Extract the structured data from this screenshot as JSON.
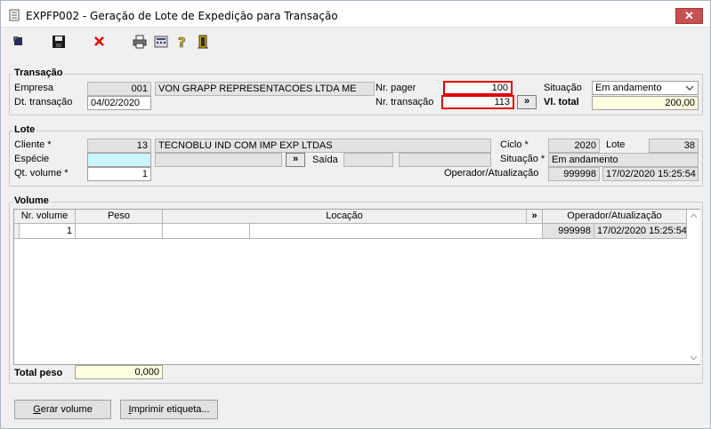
{
  "window": {
    "title": "EXPFP002 - Geração de Lote de Expedição para Transação",
    "close_label": "✕"
  },
  "toolbar": {
    "icons": [
      "exit-icon",
      "save-icon",
      "cancel-icon",
      "print-icon",
      "calculator-icon",
      "help-icon",
      "door-icon"
    ]
  },
  "transacao": {
    "title": "Transação",
    "empresa_label": "Empresa",
    "empresa_code": "001",
    "empresa_name": "VON GRAPP REPRESENTACOES LTDA ME",
    "dt_label": "Dt. transação",
    "dt_value": "04/02/2020",
    "pager_label": "Nr. pager",
    "pager_value": "100",
    "transacao_label": "Nr. transação",
    "transacao_value": "113",
    "next_label": "»",
    "situacao_label": "Situação",
    "situacao_value": "Em andamento",
    "vltotal_label": "Vl. total",
    "vltotal_value": "200,00"
  },
  "lote": {
    "title": "Lote",
    "cliente_label": "Cliente *",
    "cliente_code": "13",
    "cliente_name": "TECNOBLU IND  COM  IMP  EXP  LTDAS",
    "ciclo_label": "Ciclo *",
    "ciclo_value": "2020",
    "lote_label": "Lote",
    "lote_value": "38",
    "especie_label": "Espécie",
    "especie_value": "",
    "especie_btn": "»",
    "saida_label": "Saída",
    "situacao_label": "Situação *",
    "situacao_value": "Em andamento",
    "qtvolume_label": "Qt. volume *",
    "qtvolume_value": "1",
    "operador_label": "Operador/Atualização",
    "operador_value": "999998",
    "atualizacao_value": "17/02/2020 15:25:54"
  },
  "volume": {
    "title": "Volume",
    "columns": [
      "Nr. volume",
      "Peso",
      "Locação",
      "»",
      "Operador/Atualização"
    ],
    "rows": [
      {
        "nr": "1",
        "peso": "",
        "loc1": "",
        "loc2": "",
        "operador": "999998",
        "data": "17/02/2020 15:25:54"
      }
    ],
    "total_label": "Total peso",
    "total_value": "0,000"
  },
  "buttons": {
    "gerar_prefix": "G",
    "gerar_rest": "erar volume",
    "imprimir_prefix": "I",
    "imprimir_rest": "mprimir etiqueta..."
  }
}
